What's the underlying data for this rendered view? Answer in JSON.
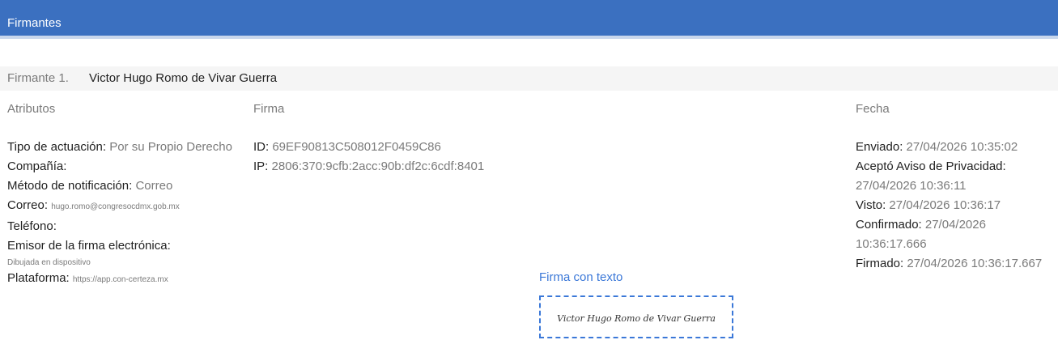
{
  "header": {
    "title": "Firmantes"
  },
  "signer": {
    "prefix": "Firmante 1.",
    "name": "Victor Hugo Romo de Vivar Guerra"
  },
  "columns": {
    "atributos": "Atributos",
    "firma": "Firma",
    "fecha": "Fecha"
  },
  "atributos": {
    "tipo_label": "Tipo de actuación:",
    "tipo_value": "Por su Propio Derecho",
    "compania_label": "Compañía:",
    "metodo_label": "Método de notificación:",
    "metodo_value": "Correo",
    "correo_label": "Correo:",
    "correo_value": "hugo.romo@congresocdmx.gob.mx",
    "telefono_label": "Teléfono:",
    "emisor_label": "Emisor de la firma electrónica:",
    "emisor_value": "Dibujada en dispositivo",
    "plataforma_label": "Plataforma:",
    "plataforma_value": "https://app.con-certeza.mx"
  },
  "firma": {
    "id_label": "ID:",
    "id_value": "69EF90813C508012F0459C86",
    "ip_label": "IP:",
    "ip_value": "2806:370:9cfb:2acc:90b:df2c:6cdf:8401",
    "signature_label": "Firma con texto",
    "signature_text": "Victor Hugo  Romo de Vivar Guerra"
  },
  "fecha": {
    "enviado_label": "Enviado:",
    "enviado_value": "27/04/2026 10:35:02",
    "acepto_label": "Aceptó Aviso de Privacidad:",
    "acepto_value": "27/04/2026 10:36:11",
    "visto_label": "Visto:",
    "visto_value": "27/04/2026 10:36:17",
    "confirmado_label": "Confirmado:",
    "confirmado_value": "27/04/2026 10:36:17.666",
    "firmado_label": "Firmado:",
    "firmado_value": "27/04/2026 10:36:17.667"
  },
  "colors": {
    "header": "#3b70c0",
    "link": "#3b78d8"
  }
}
